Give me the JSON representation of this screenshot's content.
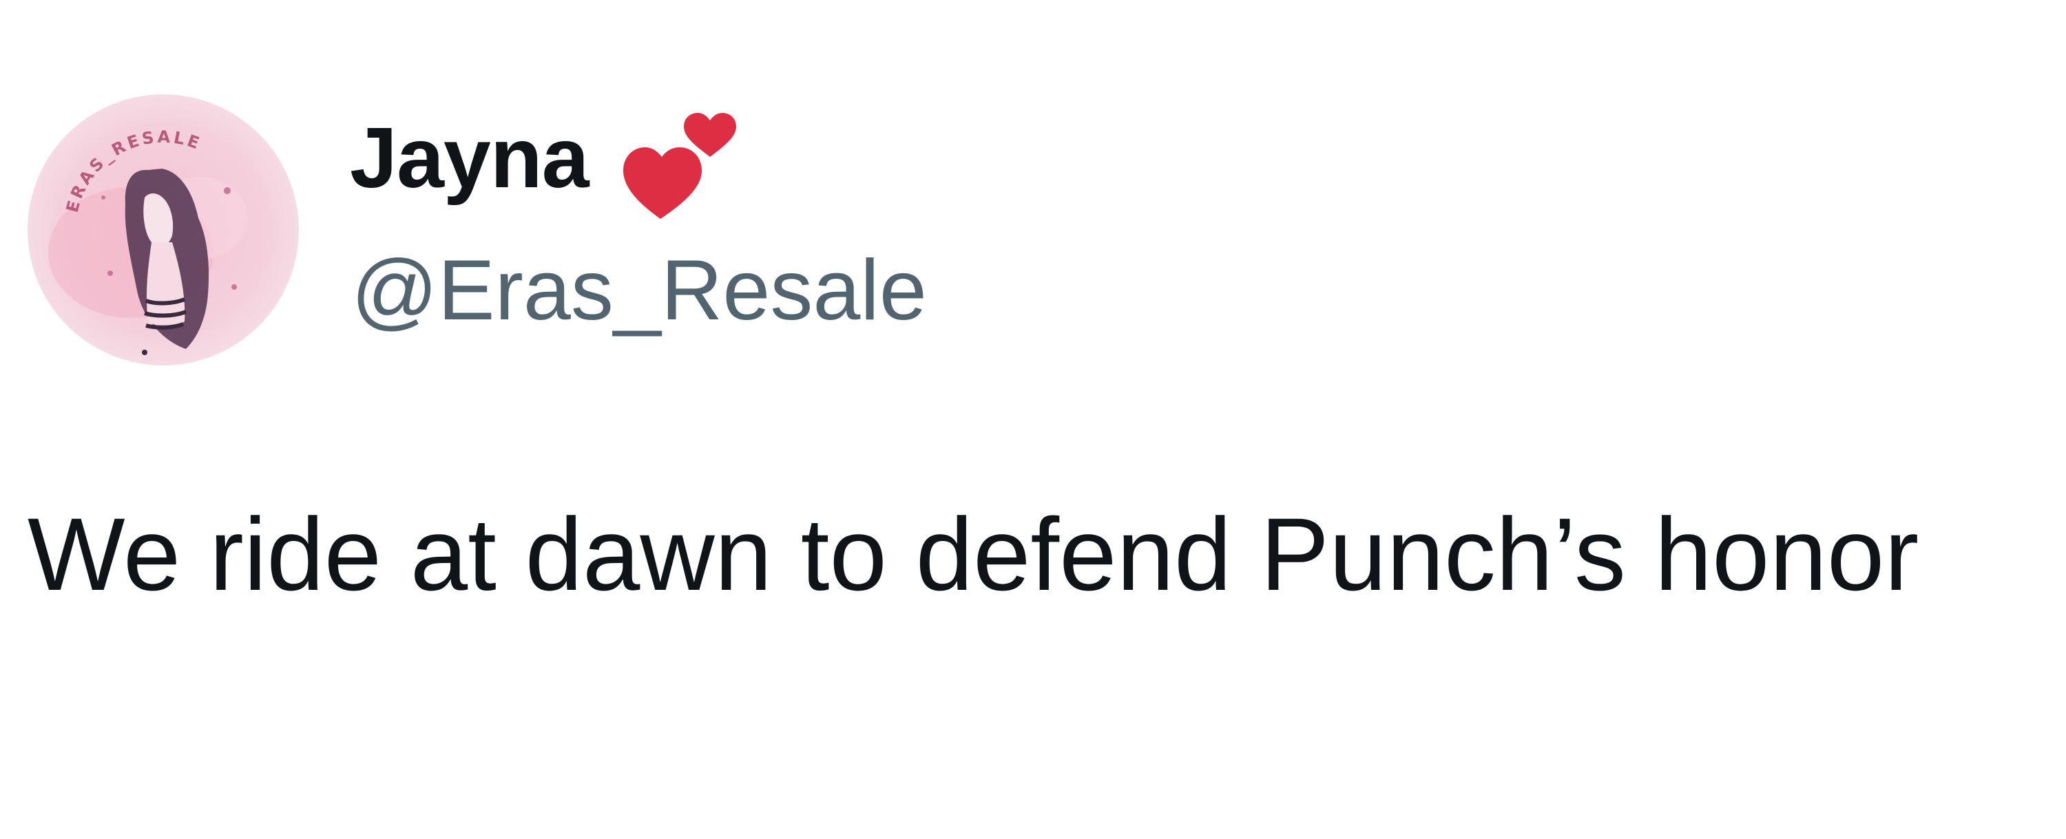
{
  "author": {
    "display_name": "Jayna",
    "name_emoji": "hearts-emoji",
    "handle": "@Eras_Resale",
    "avatar": {
      "icon": "profile-avatar",
      "ring_text": "ERAS_RESALE",
      "background": "#f3c9d6"
    }
  },
  "tweet": {
    "text": "We ride at dawn to defend Punch’s honor"
  },
  "colors": {
    "name": "#0f1419",
    "handle": "#536471",
    "body": "#0f1419",
    "heart": "#dd2e44"
  }
}
